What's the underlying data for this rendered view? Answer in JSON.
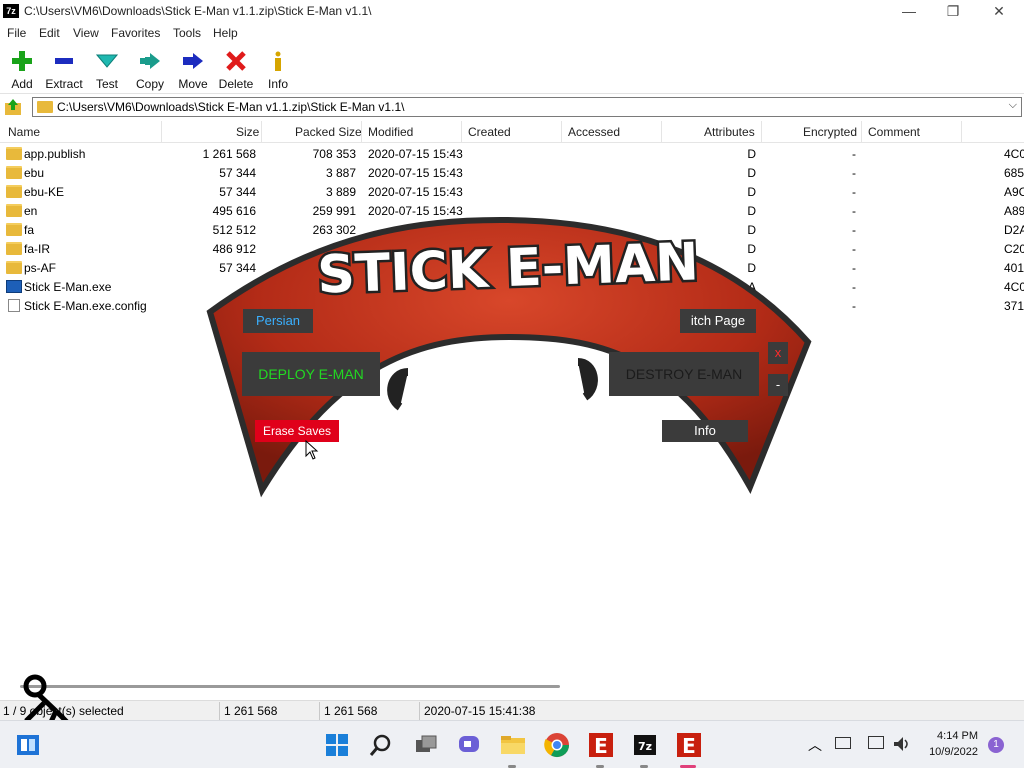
{
  "window": {
    "title": "C:\\Users\\VM6\\Downloads\\Stick E-Man v1.1.zip\\Stick E-Man v1.1\\",
    "app_icon_text": "7z",
    "minimize": "—",
    "maximize": "❐",
    "close": "✕"
  },
  "menu": [
    "File",
    "Edit",
    "View",
    "Favorites",
    "Tools",
    "Help"
  ],
  "toolbar": [
    {
      "label": "Add",
      "icon": "add-icon",
      "color": "#1aa31a"
    },
    {
      "label": "Extract",
      "icon": "extract-icon",
      "color": "#1c2cbf"
    },
    {
      "label": "Test",
      "icon": "test-icon",
      "color": "#1fb8b0"
    },
    {
      "label": "Copy",
      "icon": "copy-icon",
      "color": "#1a9c8c"
    },
    {
      "label": "Move",
      "icon": "move-icon",
      "color": "#1c2cbf"
    },
    {
      "label": "Delete",
      "icon": "delete-icon",
      "color": "#e01b1b"
    },
    {
      "label": "Info",
      "icon": "info-icon",
      "color": "#d6a500"
    }
  ],
  "address": {
    "path": "C:\\Users\\VM6\\Downloads\\Stick E-Man v1.1.zip\\Stick E-Man v1.1\\",
    "dropdown": "⌵"
  },
  "columns": [
    "Name",
    "Size",
    "Packed Size",
    "Modified",
    "Created",
    "Accessed",
    "Attributes",
    "Encrypted",
    "Comment"
  ],
  "files": [
    {
      "name": "app.publish",
      "type": "folder",
      "size": "1 261 568",
      "packed": "708 353",
      "modified": "2020-07-15 15:43",
      "attributes": "D",
      "encrypted": "-",
      "crc": "4C0"
    },
    {
      "name": "ebu",
      "type": "folder",
      "size": "57 344",
      "packed": "3 887",
      "modified": "2020-07-15 15:43",
      "attributes": "D",
      "encrypted": "-",
      "crc": "685"
    },
    {
      "name": "ebu-KE",
      "type": "folder",
      "size": "57 344",
      "packed": "3 889",
      "modified": "2020-07-15 15:43",
      "attributes": "D",
      "encrypted": "-",
      "crc": "A9C"
    },
    {
      "name": "en",
      "type": "folder",
      "size": "495 616",
      "packed": "259 991",
      "modified": "2020-07-15 15:43",
      "attributes": "D",
      "encrypted": "-",
      "crc": "A89"
    },
    {
      "name": "fa",
      "type": "folder",
      "size": "512 512",
      "packed": "263 302",
      "modified": "",
      "attributes": "D",
      "encrypted": "-",
      "crc": "D2A"
    },
    {
      "name": "fa-IR",
      "type": "folder",
      "size": "486 912",
      "packed": "",
      "modified": "",
      "attributes": "D",
      "encrypted": "-",
      "crc": "C20"
    },
    {
      "name": "ps-AF",
      "type": "folder",
      "size": "57 344",
      "packed": "",
      "modified": "",
      "attributes": "D",
      "encrypted": "-",
      "crc": "401"
    },
    {
      "name": "Stick E-Man.exe",
      "type": "exe",
      "size": "",
      "packed": "",
      "modified": "",
      "attributes": "A",
      "encrypted": "-",
      "crc": "4C0"
    },
    {
      "name": "Stick E-Man.exe.config",
      "type": "doc",
      "size": "",
      "packed": "",
      "modified": "",
      "attributes": "",
      "encrypted": "-",
      "crc": "371"
    }
  ],
  "status": {
    "selected": "1 / 9 object(s) selected",
    "size": "1 261 568",
    "packed": "1 261 568",
    "modified": "2020-07-15 15:41:38"
  },
  "game": {
    "title": "STICK E-MAN",
    "persian_label": "Persian",
    "deploy_label": "DEPLOY E-MAN",
    "erase_label": "Erase Saves",
    "itch_label": "itch Page",
    "destroy_label": "DESTROY E-MAN",
    "close_label": "x",
    "minimize_label": "-",
    "info_label": "Info",
    "colors": {
      "arc": "#b8321c",
      "deploy_text": "#22d922",
      "persian_text": "#3ab0ff",
      "erase_bg": "#e0001a"
    }
  },
  "taskbar": {
    "apps": [
      "start-icon",
      "search-icon",
      "task-view-icon",
      "chat-icon",
      "file-explorer-icon",
      "chrome-icon",
      "e-app-icon",
      "7zip-icon",
      "stick-e-man-icon"
    ],
    "e_letter": "E",
    "zip_letter": "7z",
    "tray_chevron": "︿",
    "time": "4:14 PM",
    "date": "10/9/2022",
    "notification_count": "1"
  }
}
